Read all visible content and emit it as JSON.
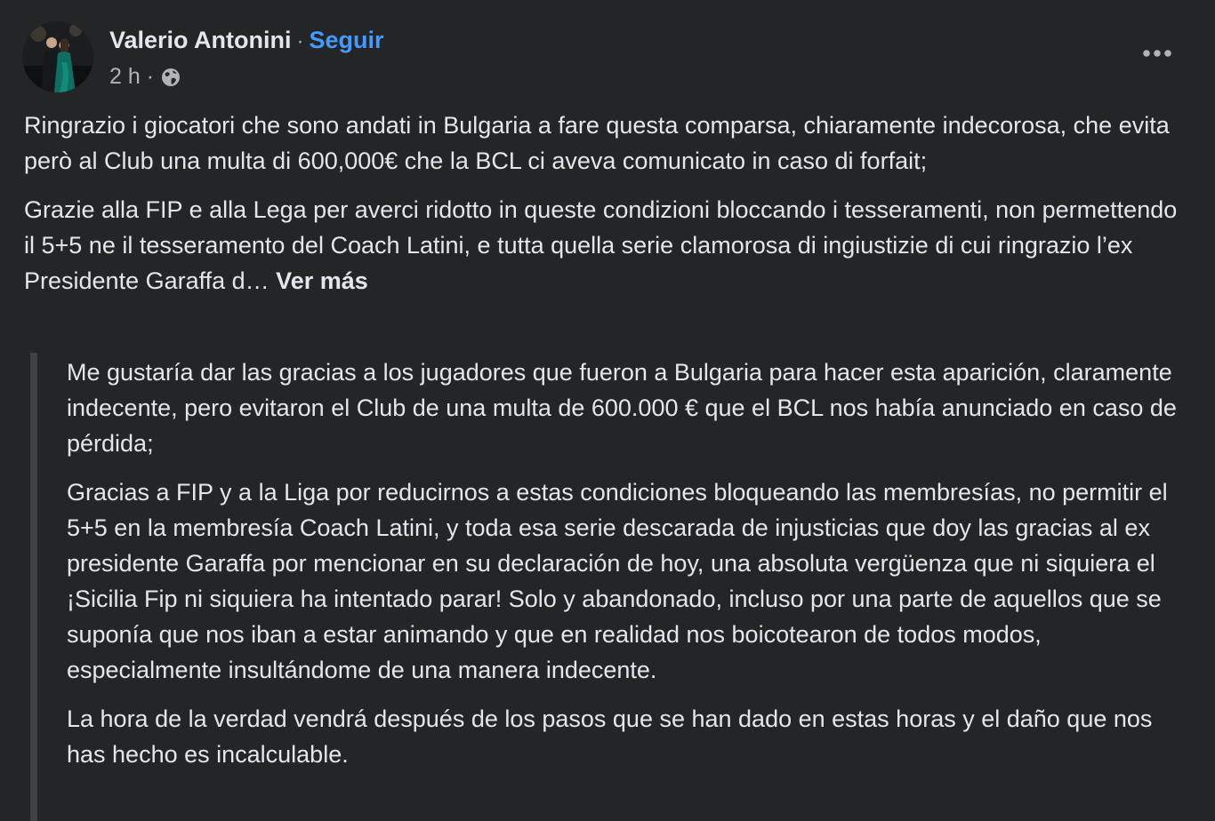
{
  "author": {
    "name": "Valerio Antonini",
    "avatar_icon": "profile-photo"
  },
  "header": {
    "separator": "·",
    "follow_label": "Seguir",
    "timestamp": "2 h",
    "meta_separator": "·",
    "audience_icon": "globe-icon",
    "more_icon": "more-options-icon"
  },
  "post": {
    "paragraphs": [
      "Ringrazio i giocatori che sono andati in Bulgaria a fare questa comparsa, chiaramente indecorosa, che evita però al Club una multa di 600,000€ che la BCL ci aveva comunicato in caso di forfait;",
      "Grazie alla FIP e alla Lega per averci ridotto in queste condizioni bloccando i tesseramenti, non permettendo il 5+5 ne il tesseramento del Coach Latini, e tutta quella serie clamorosa di ingiustizie di cui ringrazio l’ex Presidente Garaffa d…"
    ],
    "see_more_label": "Ver más"
  },
  "translation": {
    "paragraphs": [
      "Me gustaría dar las gracias a los jugadores que fueron a Bulgaria para hacer esta aparición, claramente indecente, pero evitaron el Club de una multa de 600.000 € que el BCL nos había anunciado en caso de pérdida;",
      "Gracias a FIP y a la Liga por reducirnos a estas condiciones bloqueando las membresías, no permitir el 5+5 en la membresía Coach Latini, y toda esa serie descarada de injusticias que doy las gracias al ex presidente Garaffa por mencionar en su declaración de hoy, una absoluta vergüenza que ni siquiera el ¡Sicilia Fip ni siquiera ha intentado parar! Solo y abandonado, incluso por una parte de aquellos que se suponía que nos iban a estar animando y que en realidad nos boicotearon de todos modos, especialmente insultándome de una manera indecente.",
      "La hora de la verdad vendrá después de los pasos que se han dado en estas horas y el daño que nos has hecho es incalculable."
    ]
  },
  "colors": {
    "background": "#242526",
    "text_primary": "#e4e6eb",
    "text_secondary": "#b0b3b8",
    "link_blue": "#4599ff",
    "quote_bar": "#3e4042"
  }
}
